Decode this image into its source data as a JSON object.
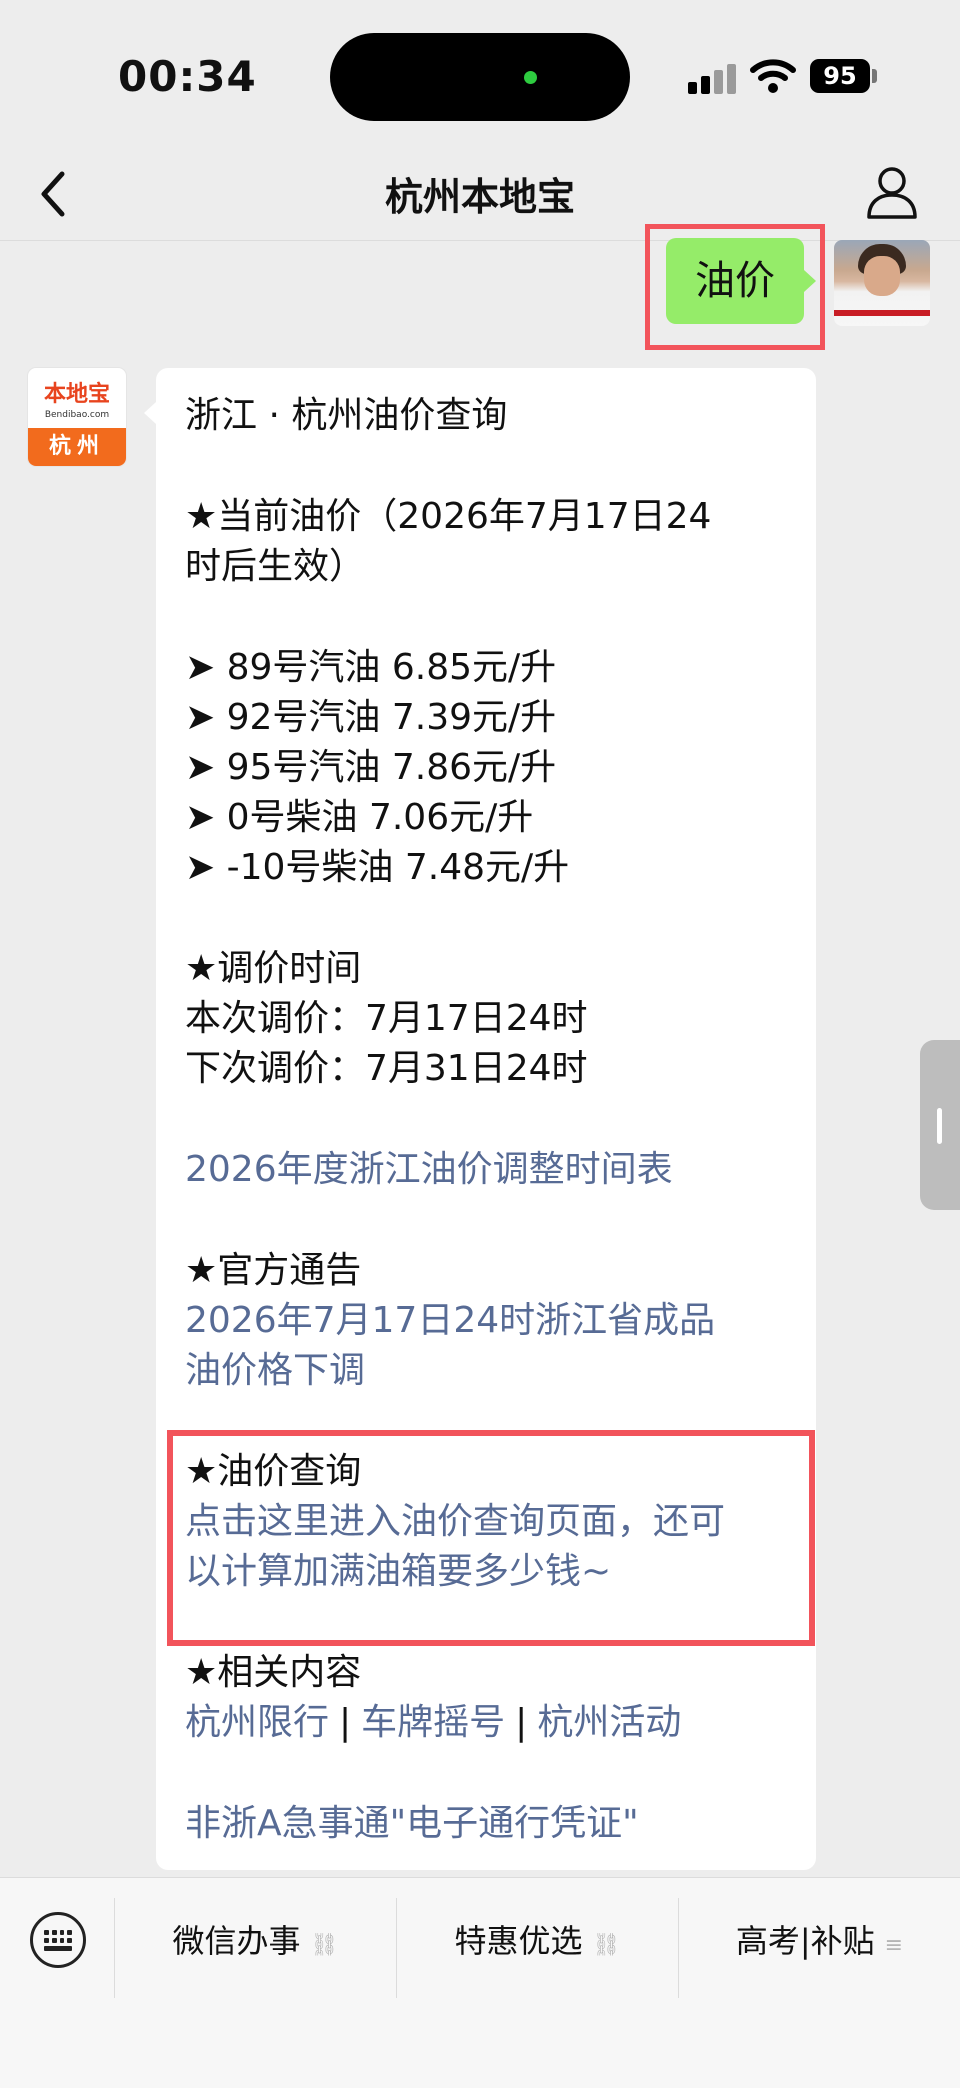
{
  "status_bar": {
    "time": "00:34",
    "battery": "95"
  },
  "nav": {
    "title": "杭州本地宝",
    "back_icon": "chevron-left-icon",
    "profile_icon": "person-icon"
  },
  "user_message": {
    "text": "油价"
  },
  "bot_avatar": {
    "top": "本地宝",
    "url": "Bendibao.com",
    "bottom": "杭州"
  },
  "bot_message": {
    "heading": "浙江 · 杭州油价查询",
    "current_price_title": "★当前油价（2026年7月17日24",
    "current_price_title_2": "时后生效）",
    "prices": [
      "➤ 89号汽油 6.85元/升",
      "➤ 92号汽油 7.39元/升",
      "➤ 95号汽油 7.86元/升",
      "➤ 0号柴油 7.06元/升",
      "➤ -10号柴油 7.48元/升"
    ],
    "adjust_title": "★调价时间",
    "this_adjust": "本次调价：7月17日24时",
    "next_adjust": "下次调价：7月31日24时",
    "schedule_link": "2026年度浙江油价调整时间表",
    "notice_title": "★官方通告",
    "notice_link_1": "2026年7月17日24时浙江省成品",
    "notice_link_2": "油价格下调",
    "query_title": "★油价查询",
    "query_link_1": "点击这里进入油价查询页面，还可",
    "query_link_2": "以计算加满油箱要多少钱~",
    "related_title": "★相关内容",
    "related_links": [
      "杭州限行",
      "车牌摇号",
      "杭州活动"
    ],
    "related_sep": "|",
    "last_link": "非浙A急事通\"电子通行凭证\""
  },
  "bottom_menu": {
    "items": [
      {
        "label": "微信办事",
        "icon": "link-icon",
        "aux": "⛓"
      },
      {
        "label": "特惠优选",
        "icon": "link-icon",
        "aux": "⛓"
      },
      {
        "label": "高考|补贴",
        "icon": "menu-icon",
        "aux": "≡"
      }
    ]
  }
}
